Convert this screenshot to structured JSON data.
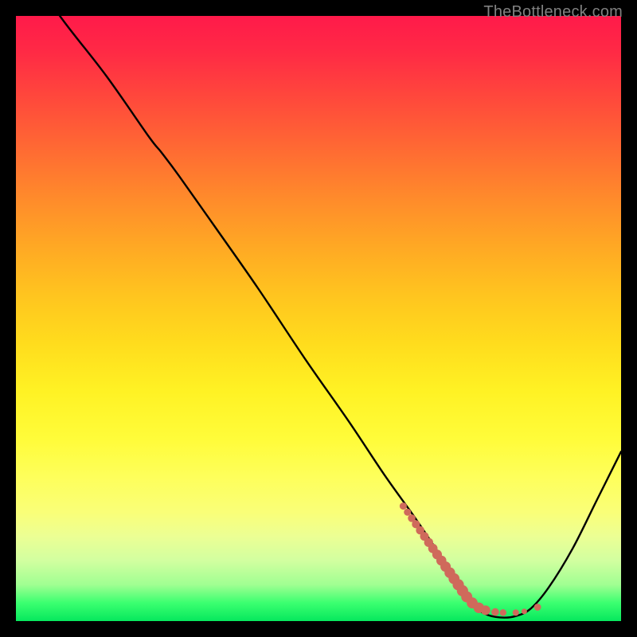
{
  "attribution": "TheBottleneck.com",
  "colors": {
    "curve_stroke": "#000000",
    "marker_fill": "#cf6a5b",
    "frame_bg": "#000000"
  },
  "chart_data": {
    "type": "line",
    "title": "",
    "xlabel": "",
    "ylabel": "",
    "xlim": [
      0,
      100
    ],
    "ylim": [
      0,
      100
    ],
    "series": [
      {
        "name": "bottleneck-curve",
        "x": [
          0,
          8,
          15,
          22,
          24,
          27,
          33,
          40,
          48,
          55,
          61,
          66,
          70,
          73,
          75,
          77.5,
          80,
          82.5,
          85,
          88,
          92,
          96,
          100
        ],
        "y": [
          110,
          99,
          90,
          80,
          77.5,
          73.5,
          65,
          55,
          43,
          33,
          24,
          17,
          11,
          6,
          3,
          1.2,
          0.6,
          0.8,
          2,
          5.5,
          12,
          20,
          28
        ]
      }
    ],
    "markers": {
      "name": "highlight-points",
      "points": [
        {
          "x": 64.0,
          "y": 19.0,
          "r": 4.5
        },
        {
          "x": 64.7,
          "y": 18.0,
          "r": 4.5
        },
        {
          "x": 65.4,
          "y": 17.0,
          "r": 4.8
        },
        {
          "x": 66.1,
          "y": 16.0,
          "r": 5.1
        },
        {
          "x": 66.8,
          "y": 15.0,
          "r": 5.3
        },
        {
          "x": 67.5,
          "y": 14.0,
          "r": 5.5
        },
        {
          "x": 68.2,
          "y": 13.0,
          "r": 5.7
        },
        {
          "x": 68.9,
          "y": 12.0,
          "r": 5.9
        },
        {
          "x": 69.6,
          "y": 11.0,
          "r": 6.1
        },
        {
          "x": 70.3,
          "y": 10.0,
          "r": 6.3
        },
        {
          "x": 71.0,
          "y": 9.0,
          "r": 6.5
        },
        {
          "x": 71.7,
          "y": 8.0,
          "r": 6.7
        },
        {
          "x": 72.4,
          "y": 7.0,
          "r": 6.9
        },
        {
          "x": 73.1,
          "y": 6.0,
          "r": 7.1
        },
        {
          "x": 73.8,
          "y": 5.0,
          "r": 7.1
        },
        {
          "x": 74.5,
          "y": 4.0,
          "r": 7.0
        },
        {
          "x": 75.4,
          "y": 3.0,
          "r": 6.9
        },
        {
          "x": 76.5,
          "y": 2.2,
          "r": 6.7
        },
        {
          "x": 77.6,
          "y": 1.8,
          "r": 6.0
        },
        {
          "x": 79.2,
          "y": 1.5,
          "r": 4.8
        },
        {
          "x": 80.5,
          "y": 1.4,
          "r": 4.2
        },
        {
          "x": 82.6,
          "y": 1.4,
          "r": 4.0
        },
        {
          "x": 84.0,
          "y": 1.6,
          "r": 3.5
        },
        {
          "x": 86.2,
          "y": 2.3,
          "r": 4.4
        }
      ]
    }
  }
}
